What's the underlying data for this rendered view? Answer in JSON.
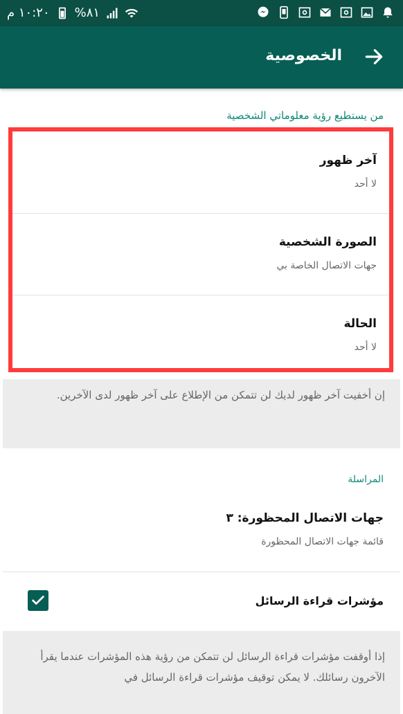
{
  "status_bar": {
    "time": "١٠:٢٠ م",
    "battery_percent": "%٨١",
    "right_icons": [
      "bell-icon",
      "image-icon",
      "email-icon",
      "email-icon",
      "mail-icon",
      "email-icon",
      "phone-icon",
      "messenger-icon"
    ],
    "left_icons": [
      "battery-icon",
      "signal-icon",
      "wifi-icon"
    ]
  },
  "app_bar": {
    "title": "الخصوصية",
    "back_icon": "arrow-right-icon"
  },
  "section_who_can_see": {
    "title": "من يستطيع رؤية معلوماتي الشخصية"
  },
  "privacy_rows": [
    {
      "title": "آخر ظهور",
      "value": "لا أحد"
    },
    {
      "title": "الصورة الشخصية",
      "value": "جهات الاتصال الخاصة بي"
    },
    {
      "title": "الحالة",
      "value": "لا أحد"
    }
  ],
  "last_seen_info": "إن أخفيت آخر ظهور لديك لن تتمكن من الإطلاع على آخر ظهور لدى الآخرين.",
  "section_messaging": {
    "title": "المراسلة"
  },
  "blocked_contacts": {
    "title": "جهات الاتصال المحظورة: ٣",
    "subtitle": "قائمة جهات الاتصال المحظورة"
  },
  "read_receipts": {
    "title": "مؤشرات قراءة الرسائل",
    "checked": true
  },
  "read_receipts_info": "إذا أوقفت مؤشرات قراءة الرسائل لن تتمكن من رؤية هذه المؤشرات عندما يقرأ الآخرون رسائلك. لا يمكن توقيف مؤشرات قراءة الرسائل في",
  "colors": {
    "status_bar": "#0b4f45",
    "app_bar": "#075e54",
    "accent": "#0e8a75",
    "highlight_border": "#ff3b3b"
  }
}
